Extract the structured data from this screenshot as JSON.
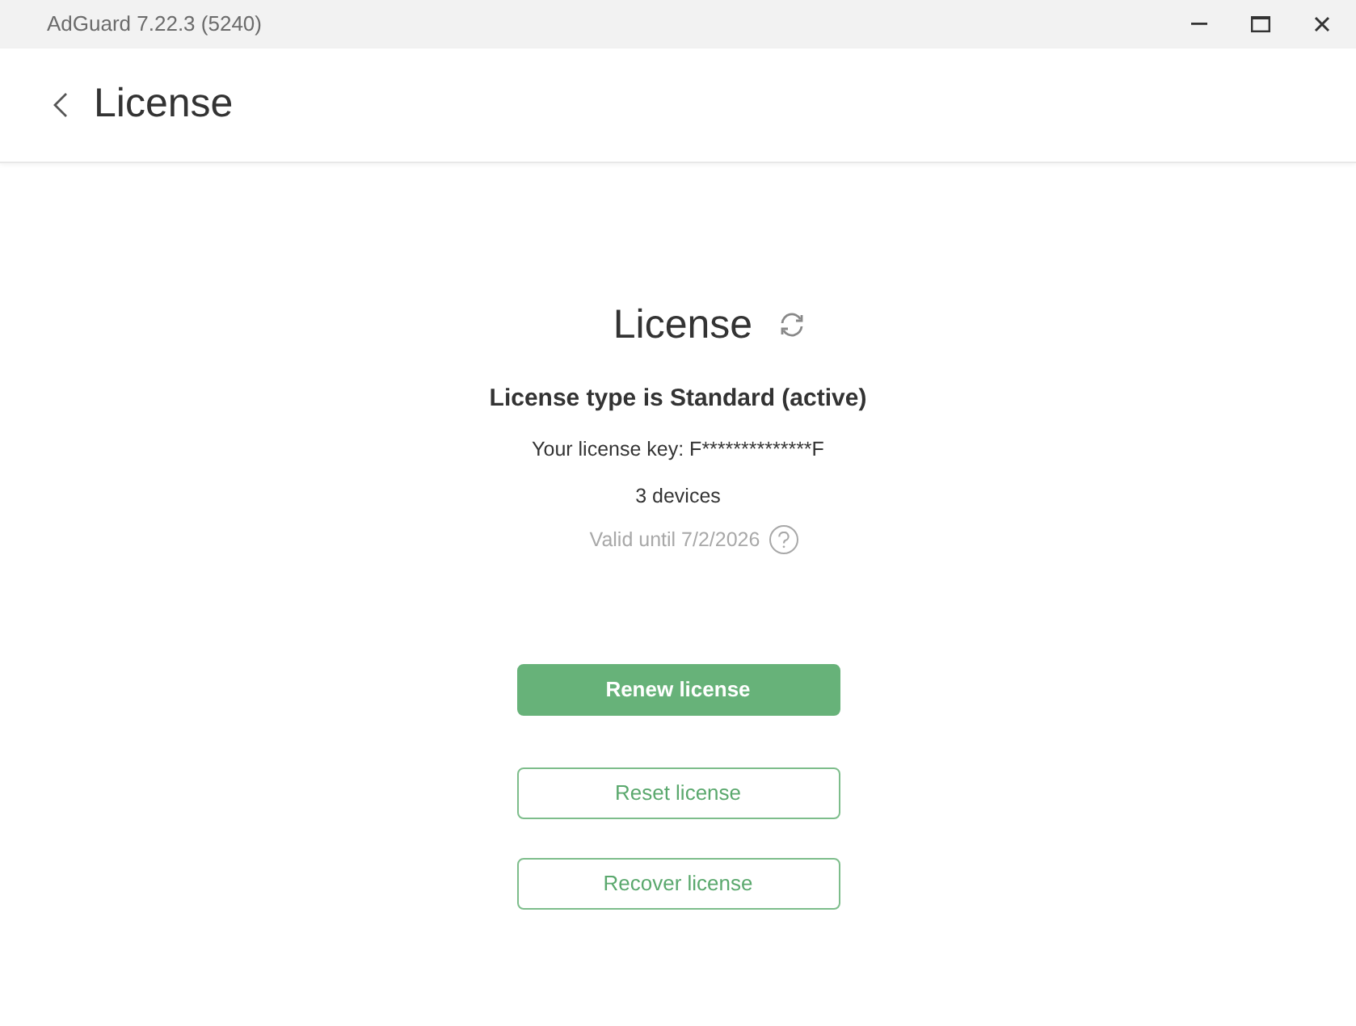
{
  "window": {
    "title": "AdGuard 7.22.3 (5240)"
  },
  "header": {
    "title": "License"
  },
  "license": {
    "heading": "License",
    "type": "License type is Standard (active)",
    "key": "Your license key: F**************F",
    "devices": "3 devices",
    "valid_until": "Valid until 7/2/2026"
  },
  "buttons": [
    {
      "label": "Renew license",
      "kind": "primary"
    },
    {
      "label": "Reset license",
      "kind": "outline"
    },
    {
      "label": "Recover license",
      "kind": "outline"
    }
  ]
}
